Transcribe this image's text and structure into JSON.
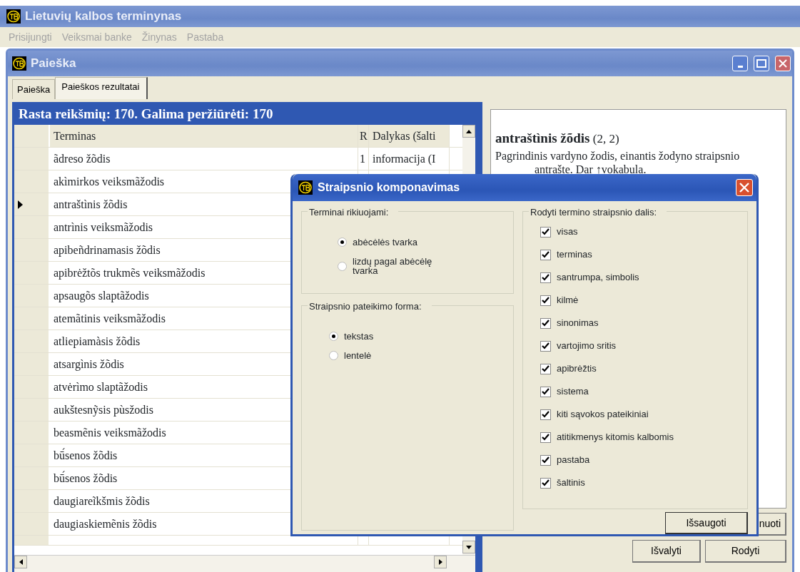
{
  "app": {
    "title": "Lietuvių kalbos terminynas"
  },
  "menu": [
    "Prisijungti",
    "Veiksmai banke",
    "Žinynas",
    "Pastaba"
  ],
  "window": {
    "title": "Paieška"
  },
  "tabs": [
    {
      "label": "Paieška",
      "selected": false
    },
    {
      "label": "Paieškos rezultatai",
      "selected": true
    }
  ],
  "results": {
    "header": "Rasta reikšmių: 170. Galima peržiūrėti: 170",
    "columns": [
      "Terminas",
      "R",
      "Dalykas (šalti"
    ],
    "rows": [
      {
        "term": "ãdreso žõdis",
        "r": "1",
        "subject": "informacija (I",
        "selected": false
      },
      {
        "term": "akìmirkos veiksmãžodis",
        "selected": false
      },
      {
        "term": "antraštìnis žõdis",
        "selected": true
      },
      {
        "term": "antrìnis veiksmãžodis",
        "selected": false
      },
      {
        "term": "apibeñdrinamasis žõdis",
        "selected": false
      },
      {
        "term": "apibrėžtõs  trukmẽs veiksmãžodis",
        "selected": false
      },
      {
        "term": "apsaugõs slaptãžodis",
        "selected": false
      },
      {
        "term": "atemãtinis veiksmãžodis",
        "selected": false
      },
      {
        "term": "atliepiamàsis žõdis",
        "selected": false
      },
      {
        "term": "atsargìnis žõdis",
        "selected": false
      },
      {
        "term": "atvėrìmo slaptãžodis",
        "selected": false
      },
      {
        "term": "aukštesnỹsis pùsžodis",
        "selected": false
      },
      {
        "term": "beasmẽnis veiksmãžodis",
        "selected": false
      },
      {
        "term": "bū́senos žõdis",
        "selected": false
      },
      {
        "term": "bū́senos žõdis",
        "selected": false
      },
      {
        "term": "daugiareĩkšmis žõdis",
        "selected": false
      },
      {
        "term": "daugiaskiemẽnis žõdis",
        "selected": false
      }
    ]
  },
  "preview": {
    "heading": "**antraštìnis žõdis** (2, 2)",
    "definition": "Pagrindinis vardyno žodis, einantis žodyno straipsnio antrašte. Dar ↑vokabula."
  },
  "buttons": [
    "nuoti",
    "Išvalyti",
    "Rodyti"
  ],
  "dialog": {
    "title": "Straipsnio komponavimas",
    "sort": {
      "label": "Terminai rikiuojami:",
      "options": [
        {
          "label": "abėcėlės tvarka",
          "selected": true
        },
        {
          "label": "lizdų pagal abėcėlę tvarka",
          "selected": false
        }
      ]
    },
    "form": {
      "label": "Straipsnio pateikimo forma:",
      "options": [
        {
          "label": "tekstas",
          "selected": true
        },
        {
          "label": "lentelė",
          "selected": false
        }
      ]
    },
    "parts": {
      "label": "Rodyti termino straipsnio dalis:",
      "items": [
        {
          "label": "visas",
          "checked": true
        },
        {
          "label": "terminas",
          "checked": true
        },
        {
          "label": "santrumpa, simbolis",
          "checked": true
        },
        {
          "label": "kilmė",
          "checked": true
        },
        {
          "label": "sinonimas",
          "checked": true
        },
        {
          "label": "vartojimo sritis",
          "checked": true
        },
        {
          "label": "apibrėžtis",
          "checked": true
        },
        {
          "label": "sistema",
          "checked": true
        },
        {
          "label": "kiti sąvokos pateikiniai",
          "checked": true
        },
        {
          "label": "atitikmenys kitomis kalbomis",
          "checked": true
        },
        {
          "label": "pastaba",
          "checked": true
        },
        {
          "label": "šaltinis",
          "checked": true
        }
      ]
    },
    "save": "Išsaugoti"
  }
}
